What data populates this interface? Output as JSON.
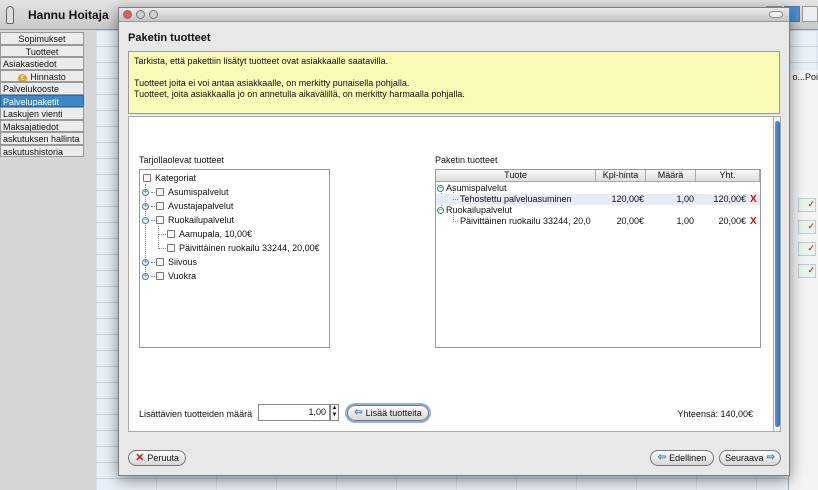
{
  "app": {
    "title": "Hannu Hoitaja",
    "sidebar": [
      {
        "label": "Sopimukset",
        "selected": false,
        "center": true
      },
      {
        "label": "Tuotteet",
        "selected": false,
        "center": true
      },
      {
        "label": "Asiakastiedot",
        "selected": false,
        "center": false
      },
      {
        "label": "Hinnasto",
        "selected": false,
        "center": true,
        "icon": "euro-coin-icon"
      },
      {
        "label": "Palvelukooste",
        "selected": false,
        "center": false
      },
      {
        "label": "Palvelupaketit",
        "selected": true,
        "center": false
      },
      {
        "label": "Laskujen vienti",
        "selected": false,
        "center": false
      },
      {
        "label": "Maksajatiedot",
        "selected": false,
        "center": false
      },
      {
        "label": "askutuksen hallinta",
        "selected": false,
        "center": false
      },
      {
        "label": "askutushistoria",
        "selected": false,
        "center": false
      }
    ],
    "right_header": "o...Poi",
    "coin_symbol": "€"
  },
  "dialog": {
    "title": "Paketin tuotteet",
    "info_lines": [
      "Tarkista, että pakettiin lisätyt tuotteet ovat asiakkaalle saatavilla.",
      "Tuotteet joita ei voi antaa asiakkaalle, on merkitty punaisella pohjalla.",
      "Tuotteet, joita asiakkaalla jo on annetulla aikavälillä, on merkitty harmaalla pohjalla."
    ],
    "available_label": "Tarjollaolevat tuotteet",
    "package_label": "Paketin tuotteet",
    "tree": {
      "root": "Kategoriat",
      "categories": [
        {
          "label": "Asumispalvelut",
          "expanded": false,
          "children": []
        },
        {
          "label": "Avustajapalvelut",
          "expanded": false,
          "children": []
        },
        {
          "label": "Ruokailupalvelut",
          "expanded": true,
          "children": [
            "Aamupala, 10,00€",
            "Päivittäinen ruokailu 33244, 20,00€"
          ]
        },
        {
          "label": "Siivous",
          "expanded": false,
          "children": []
        },
        {
          "label": "Vuokra",
          "expanded": false,
          "children": []
        }
      ]
    },
    "table": {
      "columns": [
        "Tuote",
        "Kpl-hinta",
        "Määrä",
        "Yht."
      ],
      "groups": [
        {
          "name": "Asumispalvelut",
          "rows": [
            {
              "product": "Tehostettu palveluasuminen",
              "unit_price": "120,00€",
              "qty": "1,00",
              "total": "120,00€"
            }
          ]
        },
        {
          "name": "Ruokailupalvelut",
          "rows": [
            {
              "product": "Päivittäinen ruokailu 33244, 20,0",
              "unit_price": "20,00€",
              "qty": "1,00",
              "total": "20,00€"
            }
          ]
        }
      ],
      "delete_glyph": "X"
    },
    "qty_label": "Lisättävien tuotteiden määrä",
    "qty_value": "1,00",
    "add_button": "Lisää tuotteita",
    "total_text": "Yhteensä: 140,00€",
    "cancel_button": "Peruuta",
    "prev_button": "Edellinen",
    "next_button": "Seuraava"
  },
  "colors": {
    "info_bg": "#fbfbb8",
    "selected": "#3d86c9",
    "delete": "#d01010"
  }
}
